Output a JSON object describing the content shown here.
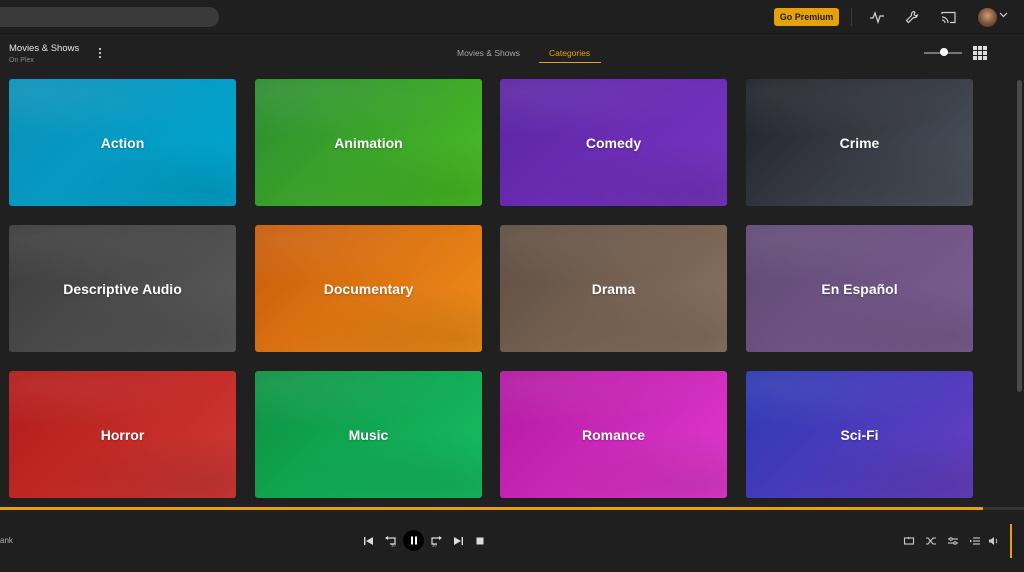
{
  "header": {
    "premium_label": "Go Premium",
    "icons": [
      "activity-icon",
      "wrench-icon",
      "cast-icon",
      "avatar",
      "chevron-down-icon"
    ]
  },
  "library": {
    "title": "Movies & Shows",
    "subtitle": "On Plex",
    "tabs": [
      {
        "label": "Movies & Shows",
        "active": false
      },
      {
        "label": "Categories",
        "active": true
      }
    ]
  },
  "categories": [
    {
      "label": "Action",
      "color_from": "#0a8fb8",
      "color_to": "#00a7d0"
    },
    {
      "label": "Animation",
      "color_from": "#2a8a30",
      "color_to": "#4cbf24"
    },
    {
      "label": "Comedy",
      "color_from": "#5a24a3",
      "color_to": "#7a35c4"
    },
    {
      "label": "Crime",
      "color_from": "#1e2028",
      "color_to": "#50555f"
    },
    {
      "label": "Descriptive Audio",
      "color_from": "#3a3a3a",
      "color_to": "#5c5c5c"
    },
    {
      "label": "Documentary",
      "color_from": "#c75a0a",
      "color_to": "#f2901a"
    },
    {
      "label": "Drama",
      "color_from": "#5c4c40",
      "color_to": "#8c7562"
    },
    {
      "label": "En Español",
      "color_from": "#5e4873",
      "color_to": "#7d5f92"
    },
    {
      "label": "Horror",
      "color_from": "#b01a18",
      "color_to": "#d23a36"
    },
    {
      "label": "Music",
      "color_from": "#0c9040",
      "color_to": "#16c064"
    },
    {
      "label": "Romance",
      "color_from": "#b016a0",
      "color_to": "#e43bd0"
    },
    {
      "label": "Sci-Fi",
      "color_from": "#2a38b2",
      "color_to": "#6a3fc4"
    }
  ],
  "player": {
    "track_title": "ank",
    "progress": 0.96
  },
  "colors": {
    "accent": "#e5a00d",
    "background": "#202020"
  }
}
